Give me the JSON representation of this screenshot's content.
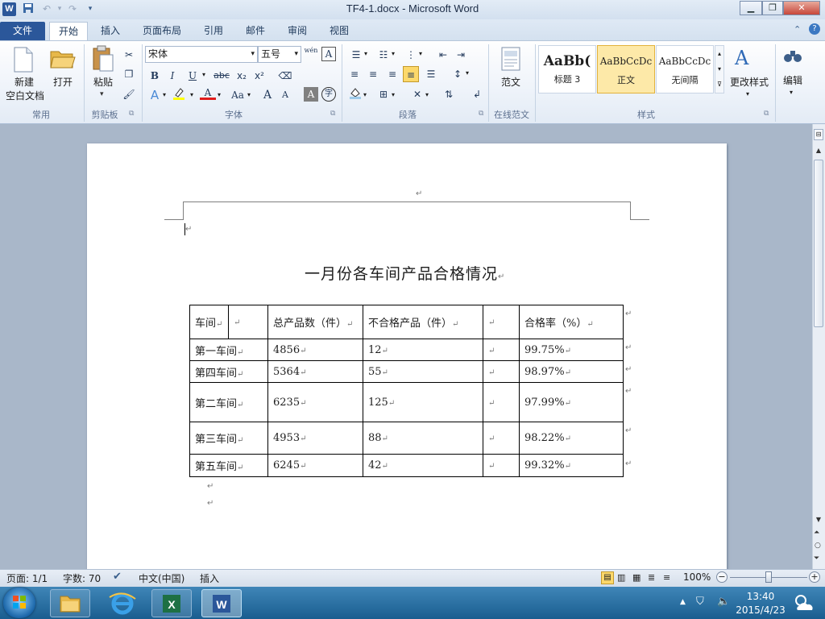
{
  "window": {
    "title": "TF4-1.docx - Microsoft Word",
    "app_icon": "W"
  },
  "tabs": [
    "文件",
    "开始",
    "插入",
    "页面布局",
    "引用",
    "邮件",
    "审阅",
    "视图"
  ],
  "ribbon": {
    "clipboard": {
      "new_label": "新建",
      "new_sub": "空白文档",
      "open_label": "打开",
      "paste_label": "粘贴",
      "group_common": "常用",
      "group_label": "剪贴板"
    },
    "font": {
      "font_name": "宋体",
      "font_size": "五号",
      "group_label": "字体",
      "bold": "B",
      "italic": "I",
      "underline": "U",
      "strike": "abc",
      "sub": "x₂",
      "sup": "x²",
      "change_case": "Aa",
      "font_color": "A",
      "grow": "A",
      "shrink": "A",
      "wen": "wén",
      "char_border": "A",
      "char_shade": "A",
      "enclose": "字"
    },
    "paragraph": {
      "group_label": "段落"
    },
    "template": {
      "label": "范文",
      "group_label": "在线范文"
    },
    "styles": {
      "group_label": "样式",
      "cards": [
        {
          "preview": "AaBb(",
          "name": "标题 3"
        },
        {
          "preview": "AaBbCcDc",
          "name": "正文"
        },
        {
          "preview": "AaBbCcDc",
          "name": "无间隔"
        }
      ],
      "change_label": "更改样式"
    },
    "editing": {
      "label": "编辑"
    }
  },
  "document": {
    "title": "一月份各车间产品合格情况",
    "para_mark": "↵",
    "table": {
      "headers": [
        "车间",
        "",
        "总产品数（件）",
        "不合格产品（件）",
        "",
        "合格率（%）"
      ],
      "rows": [
        [
          "第一车间",
          "4856",
          "12",
          "",
          "99.75%"
        ],
        [
          "第四车间",
          "5364",
          "55",
          "",
          "98.97%"
        ],
        [
          "第二车间",
          "6235",
          "125",
          "",
          "97.99%"
        ],
        [
          "第三车间",
          "4953",
          "88",
          "",
          "98.22%"
        ],
        [
          "第五车间",
          "6245",
          "42",
          "",
          "99.32%"
        ]
      ]
    }
  },
  "status": {
    "page": "页面: 1/1",
    "words": "字数: 70",
    "language": "中文(中国)",
    "mode": "插入",
    "zoom": "100%"
  },
  "taskbar": {
    "time": "13:40",
    "date": "2015/4/23"
  },
  "colors": {
    "accent": "#2b579a",
    "taskbar": "#2a6ea3"
  }
}
